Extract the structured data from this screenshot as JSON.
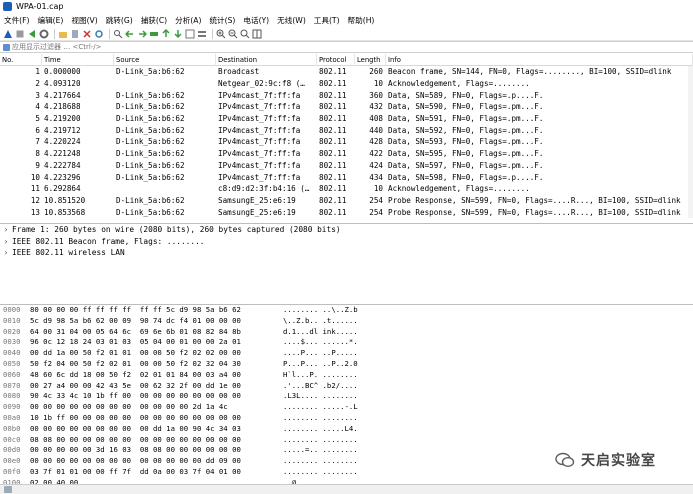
{
  "window": {
    "title": "WPA-01.cap"
  },
  "menu": [
    "文件(F)",
    "编辑(E)",
    "视图(V)",
    "跳转(G)",
    "捕获(C)",
    "分析(A)",
    "统计(S)",
    "电话(Y)",
    "无线(W)",
    "工具(T)",
    "帮助(H)"
  ],
  "filter": {
    "placeholder": "应用显示过滤器 … <Ctrl-/>"
  },
  "columns": [
    "No.",
    "Time",
    "Source",
    "Destination",
    "Protocol",
    "Length",
    "Info"
  ],
  "packets": [
    {
      "no": "1",
      "time": "0.000000",
      "src": "D-Link_5a:b6:62",
      "dst": "Broadcast",
      "proto": "802.11",
      "len": "260",
      "info": "Beacon frame, SN=144, FN=0, Flags=........, BI=100, SSID=dlink"
    },
    {
      "no": "2",
      "time": "4.093120",
      "src": "",
      "dst": "Netgear_02:9c:f8 (…",
      "proto": "802.11",
      "len": "10",
      "info": "Acknowledgement, Flags=........"
    },
    {
      "no": "3",
      "time": "4.217664",
      "src": "D-Link_5a:b6:62",
      "dst": "IPv4mcast_7f:ff:fa",
      "proto": "802.11",
      "len": "360",
      "info": "Data, SN=589, FN=0, Flags=.p....F."
    },
    {
      "no": "4",
      "time": "4.218688",
      "src": "D-Link_5a:b6:62",
      "dst": "IPv4mcast_7f:ff:fa",
      "proto": "802.11",
      "len": "432",
      "info": "Data, SN=590, FN=0, Flags=.pm...F."
    },
    {
      "no": "5",
      "time": "4.219200",
      "src": "D-Link_5a:b6:62",
      "dst": "IPv4mcast_7f:ff:fa",
      "proto": "802.11",
      "len": "408",
      "info": "Data, SN=591, FN=0, Flags=.pm...F."
    },
    {
      "no": "6",
      "time": "4.219712",
      "src": "D-Link_5a:b6:62",
      "dst": "IPv4mcast_7f:ff:fa",
      "proto": "802.11",
      "len": "440",
      "info": "Data, SN=592, FN=0, Flags=.pm...F."
    },
    {
      "no": "7",
      "time": "4.220224",
      "src": "D-Link_5a:b6:62",
      "dst": "IPv4mcast_7f:ff:fa",
      "proto": "802.11",
      "len": "428",
      "info": "Data, SN=593, FN=0, Flags=.pm...F."
    },
    {
      "no": "8",
      "time": "4.221248",
      "src": "D-Link_5a:b6:62",
      "dst": "IPv4mcast_7f:ff:fa",
      "proto": "802.11",
      "len": "422",
      "info": "Data, SN=595, FN=0, Flags=.pm...F."
    },
    {
      "no": "9",
      "time": "4.222784",
      "src": "D-Link_5a:b6:62",
      "dst": "IPv4mcast_7f:ff:fa",
      "proto": "802.11",
      "len": "424",
      "info": "Data, SN=597, FN=0, Flags=.pm...F."
    },
    {
      "no": "10",
      "time": "4.223296",
      "src": "D-Link_5a:b6:62",
      "dst": "IPv4mcast_7f:ff:fa",
      "proto": "802.11",
      "len": "434",
      "info": "Data, SN=598, FN=0, Flags=.p....F."
    },
    {
      "no": "11",
      "time": "6.292864",
      "src": "",
      "dst": "c8:d9:d2:3f:b4:16 (…",
      "proto": "802.11",
      "len": "10",
      "info": "Acknowledgement, Flags=........"
    },
    {
      "no": "12",
      "time": "10.851520",
      "src": "D-Link_5a:b6:62",
      "dst": "SamsungE_25:e6:19",
      "proto": "802.11",
      "len": "254",
      "info": "Probe Response, SN=599, FN=0, Flags=....R..., BI=100, SSID=dlink"
    },
    {
      "no": "13",
      "time": "10.853568",
      "src": "D-Link_5a:b6:62",
      "dst": "SamsungE_25:e6:19",
      "proto": "802.11",
      "len": "254",
      "info": "Probe Response, SN=599, FN=0, Flags=....R..., BI=100, SSID=dlink"
    }
  ],
  "details": [
    "Frame 1: 260 bytes on wire (2080 bits), 260 bytes captured (2080 bits)",
    "IEEE 802.11 Beacon frame, Flags: ........",
    "IEEE 802.11 wireless LAN"
  ],
  "hex": [
    {
      "off": "0000",
      "hex": "80 00 00 00 ff ff ff ff  ff ff 5c d9 98 5a b6 62",
      "asc": "........ ..\\..Z.b"
    },
    {
      "off": "0010",
      "hex": "5c d9 98 5a b6 62 00 09  90 74 dc f4 01 00 00 00",
      "asc": "\\..Z.b.. .t......"
    },
    {
      "off": "0020",
      "hex": "64 00 31 04 00 05 64 6c  69 6e 6b 01 08 82 84 8b",
      "asc": "d.1...dl ink....."
    },
    {
      "off": "0030",
      "hex": "96 0c 12 18 24 03 01 03  05 04 00 01 00 00 2a 01",
      "asc": "....$... ......*."
    },
    {
      "off": "0040",
      "hex": "00 dd 1a 00 50 f2 01 01  00 00 50 f2 02 02 00 00",
      "asc": "....P... ..P....."
    },
    {
      "off": "0050",
      "hex": "50 f2 04 00 50 f2 02 01  00 00 50 f2 02 32 04 30",
      "asc": "P...P... ..P..2.0"
    },
    {
      "off": "0060",
      "hex": "48 60 6c dd 18 00 50 f2  02 01 01 84 00 03 a4 00",
      "asc": "H`l...P. ........"
    },
    {
      "off": "0070",
      "hex": "00 27 a4 00 00 42 43 5e  00 62 32 2f 00 dd 1e 00",
      "asc": ".'...BC^ .b2/...."
    },
    {
      "off": "0080",
      "hex": "90 4c 33 4c 10 1b ff 00  00 00 00 00 00 00 00 00",
      "asc": ".L3L.... ........"
    },
    {
      "off": "0090",
      "hex": "00 00 00 00 00 00 00 00  00 00 00 00 2d 1a 4c",
      "asc": "........ .....-.L"
    },
    {
      "off": "00a0",
      "hex": "10 1b ff 00 00 00 00 00  00 00 00 00 00 00 00 00",
      "asc": "........ ........"
    },
    {
      "off": "00b0",
      "hex": "00 00 00 00 00 00 00 00  00 dd 1a 00 90 4c 34 03",
      "asc": "........ .....L4."
    },
    {
      "off": "00c0",
      "hex": "08 08 00 00 00 00 00 00  00 00 00 00 00 00 00 00",
      "asc": "........ ........"
    },
    {
      "off": "00d0",
      "hex": "00 00 00 00 00 3d 16 03  08 08 00 00 00 00 00 00",
      "asc": ".....=.. ........"
    },
    {
      "off": "00e0",
      "hex": "00 00 00 00 00 00 00 00  00 00 00 00 00 dd 09 00",
      "asc": "........ ........"
    },
    {
      "off": "00f0",
      "hex": "03 7f 01 01 00 00 ff 7f  dd 0a 00 03 7f 04 01 00",
      "asc": "........ ........"
    },
    {
      "off": "0100",
      "hex": "02 00 40 00",
      "asc": "..@."
    }
  ],
  "watermark": {
    "text": "天启实验室"
  },
  "icons": {
    "shark-fin": "#1c5fb6",
    "stop": "#d33",
    "restart": "#3a9d3a",
    "options": "#777"
  }
}
